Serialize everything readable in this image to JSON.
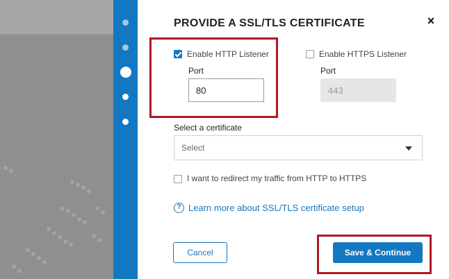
{
  "dialog": {
    "title": "PROVIDE A SSL/TLS CERTIFICATE",
    "close_icon": "×",
    "http_listener": {
      "label": "Enable HTTP Listener",
      "checked": true,
      "port_label": "Port",
      "port_value": "80"
    },
    "https_listener": {
      "label": "Enable HTTPS Listener",
      "checked": false,
      "port_label": "Port",
      "port_value": "443"
    },
    "certificate": {
      "label": "Select a certificate",
      "selected": "Select"
    },
    "redirect": {
      "label": "I want to redirect my traffic from HTTP to HTTPS",
      "checked": false
    },
    "help": {
      "icon": "?",
      "text": "Learn more about SSL/TLS certificate setup"
    },
    "buttons": {
      "cancel": "Cancel",
      "continue": "Save & Continue"
    }
  },
  "steps": {
    "count": 5,
    "current": 3
  },
  "colors": {
    "accent": "#1477c1",
    "highlight": "#b01820",
    "backdrop": "#8f8f8f"
  }
}
